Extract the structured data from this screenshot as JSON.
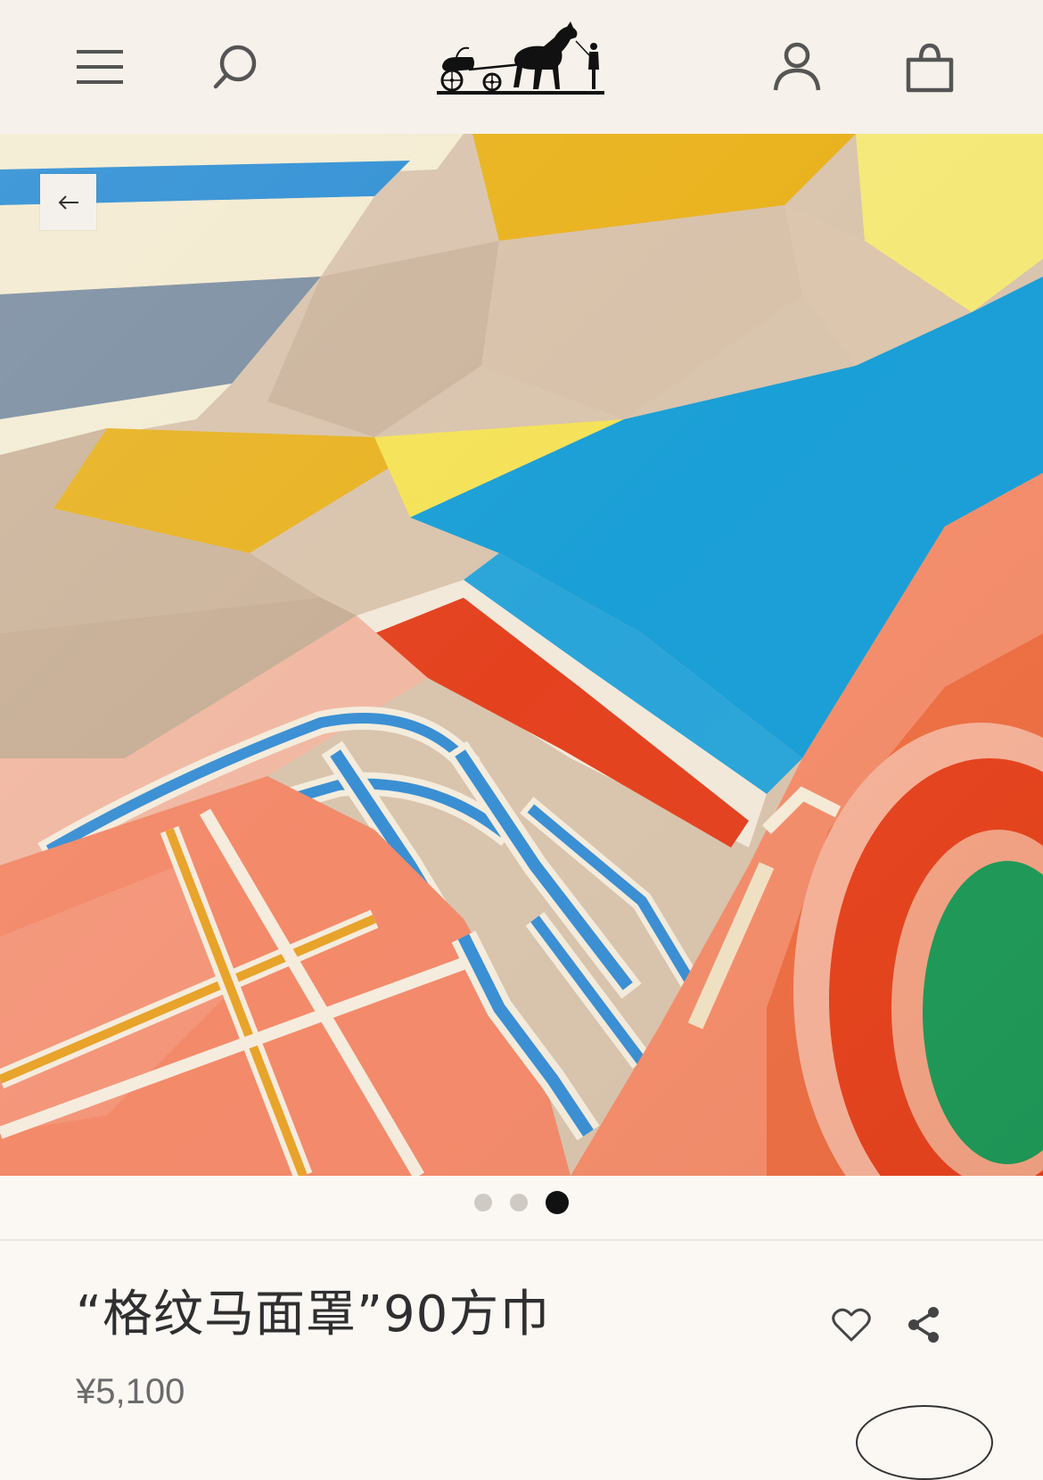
{
  "header": {
    "menu_icon": "hamburger-menu-icon",
    "search_icon": "search-icon",
    "logo": "hermes-carriage-logo",
    "account_icon": "user-icon",
    "bag_icon": "shopping-bag-icon"
  },
  "gallery": {
    "back_icon": "arrow-left-icon",
    "slide_count": 3,
    "active_slide": 3
  },
  "product": {
    "title": "“格纹马面罩”90方巾",
    "price": "¥5,100",
    "favorite_icon": "heart-icon",
    "share_icon": "share-icon"
  },
  "colors": {
    "header_bg": "#f6f1eb",
    "page_bg": "#fbf8f4",
    "blue": "#1a9fd6",
    "orange": "#f38a6a",
    "red": "#e4421f",
    "yellow": "#f6e05b",
    "green": "#1f9a58"
  }
}
